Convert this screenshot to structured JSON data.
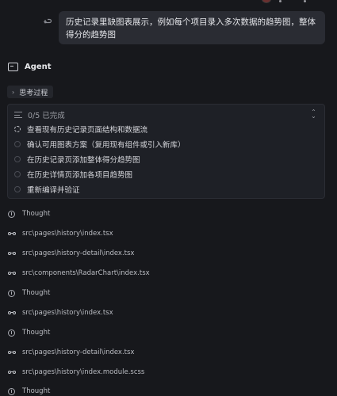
{
  "user_message": "历史记录里缺图表展示，例如每个项目录入多次数据的趋势图，整体得分的趋势图",
  "agent": {
    "name": "Agent"
  },
  "thinking": {
    "label": "思考过程"
  },
  "todo": {
    "summary": "0/5 已完成",
    "items": [
      {
        "label": "查看现有历史记录页面结构和数据流",
        "status": "in_progress"
      },
      {
        "label": "确认可用图表方案（复用现有组件或引入新库）",
        "status": "pending"
      },
      {
        "label": "在历史记录页添加整体得分趋势图",
        "status": "pending"
      },
      {
        "label": "在历史详情页添加各项目趋势图",
        "status": "pending"
      },
      {
        "label": "重新编译并验证",
        "status": "pending"
      }
    ]
  },
  "log": [
    {
      "type": "thought",
      "icon": "info-icon",
      "text": "Thought"
    },
    {
      "type": "read",
      "icon": "glasses-icon",
      "text": "src\\pages\\history\\index.tsx"
    },
    {
      "type": "read",
      "icon": "glasses-icon",
      "text": "src\\pages\\history-detail\\index.tsx"
    },
    {
      "type": "read",
      "icon": "glasses-icon",
      "text": "src\\components\\RadarChart\\index.tsx"
    },
    {
      "type": "thought",
      "icon": "info-icon",
      "text": "Thought"
    },
    {
      "type": "read",
      "icon": "glasses-icon",
      "text": "src\\pages\\history\\index.tsx"
    },
    {
      "type": "thought",
      "icon": "info-icon",
      "text": "Thought"
    },
    {
      "type": "read",
      "icon": "glasses-icon",
      "text": "src\\pages\\history-detail\\index.tsx"
    },
    {
      "type": "read",
      "icon": "glasses-icon",
      "text": "src\\pages\\history\\index.module.scss"
    },
    {
      "type": "thought",
      "icon": "info-icon",
      "text": "Thought"
    }
  ]
}
